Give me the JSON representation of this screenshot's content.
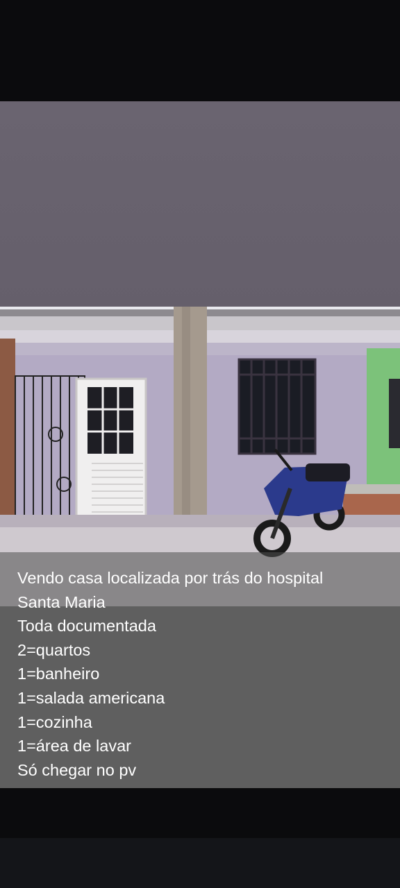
{
  "caption": {
    "lines": [
      "Vendo casa localizada por trás do hospital",
      "Santa Maria",
      "Toda documentada",
      "2=quartos",
      "1=banheiro",
      "1=salada americana",
      "1=cozinha",
      "1=área de lavar",
      "Só chegar no pv"
    ]
  },
  "colors": {
    "banner": "#67616d",
    "wall": "#b3aac4",
    "caption_background": "#5f5f5f",
    "caption_text": "#ffffff",
    "motorcycle": "#2b3a8c"
  }
}
